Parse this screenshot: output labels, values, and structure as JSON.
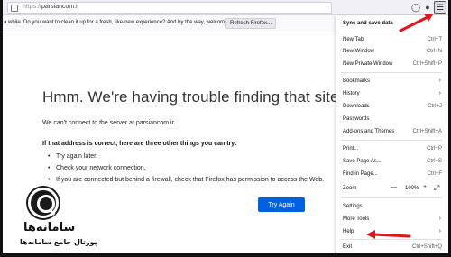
{
  "browser": {
    "url_protocol": "https://",
    "url_host": "parsiancom.ir",
    "menu_icon": "hamburger-menu-icon",
    "pocket_icon": "pocket-icon",
    "reader_icon": "reader-view-icon"
  },
  "notification": {
    "text": "a while. Do you want to clean it up for a fresh, like-new experience? And by the way, welcome back!",
    "refresh_label": "Refresh Firefox..."
  },
  "error_page": {
    "title": "Hmm. We're having trouble finding that site.",
    "description": "We can't connect to the server at parsiancom.ir.",
    "subheading": "If that address is correct, here are three other things you can try:",
    "suggestions": [
      "Try again later.",
      "Check your network connection.",
      "If you are connected but behind a firewall, check that Firefox has permission to access the Web."
    ],
    "try_again_label": "Try Again"
  },
  "logo": {
    "name": "سامانه‌ها",
    "subtitle": "پورتال جامع سامانه‌ها"
  },
  "app_menu": {
    "sync_label": "Sync and save data",
    "items": [
      {
        "label": "New Tab",
        "shortcut": "Ctrl+T"
      },
      {
        "label": "New Window",
        "shortcut": "Ctrl+N"
      },
      {
        "label": "New Private Window",
        "shortcut": "Ctrl+Shift+P"
      },
      {
        "label": "Bookmarks",
        "shortcut": ""
      },
      {
        "label": "History",
        "shortcut": ""
      },
      {
        "label": "Downloads",
        "shortcut": "Ctrl+J"
      },
      {
        "label": "Passwords",
        "shortcut": ""
      },
      {
        "label": "Add-ons and Themes",
        "shortcut": "Ctrl+Shift+A"
      },
      {
        "label": "Print...",
        "shortcut": "Ctrl+P"
      },
      {
        "label": "Save Page As...",
        "shortcut": "Ctrl+S"
      },
      {
        "label": "Find in Page...",
        "shortcut": "Ctrl+F"
      },
      {
        "label": "Zoom",
        "shortcut": ""
      },
      {
        "label": "Settings",
        "shortcut": ""
      },
      {
        "label": "More Tools",
        "shortcut": ""
      },
      {
        "label": "Help",
        "shortcut": ""
      },
      {
        "label": "Exit",
        "shortcut": "Ctrl+Shift+Q"
      }
    ],
    "zoom": {
      "minus": "—",
      "value": "100%",
      "plus": "+"
    }
  },
  "colors": {
    "accent_button": "#0061e0",
    "annotation_arrow": "#e0161c"
  }
}
